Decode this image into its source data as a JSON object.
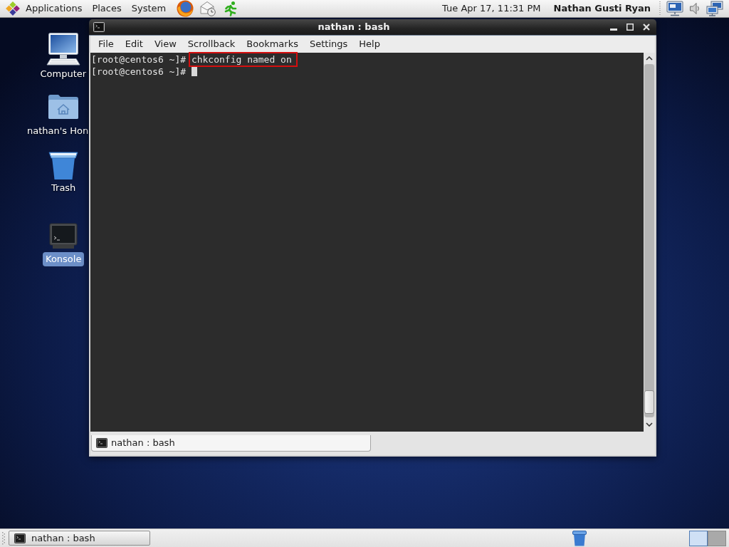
{
  "top_panel": {
    "menus": [
      "Applications",
      "Places",
      "System"
    ],
    "clock": "Tue Apr 17, 11:31 PM",
    "user": "Nathan Gusti Ryan"
  },
  "desktop_icons": [
    {
      "kind": "computer",
      "label": "Computer",
      "selected": false
    },
    {
      "kind": "home",
      "label": "nathan's Hon",
      "selected": false
    },
    {
      "kind": "trash",
      "label": "Trash",
      "selected": false
    },
    {
      "kind": "terminal",
      "label": "Konsole",
      "selected": true
    }
  ],
  "window": {
    "title": "nathan : bash",
    "menu": [
      "File",
      "Edit",
      "View",
      "Scrollback",
      "Bookmarks",
      "Settings",
      "Help"
    ],
    "terminal_lines": [
      {
        "prompt": "[root@centos6 ~]#",
        "command": "chkconfig named on",
        "highlighted": true,
        "cursor": false
      },
      {
        "prompt": "[root@centos6 ~]#",
        "highlighted": false,
        "cursor": true
      }
    ],
    "tabs": [
      {
        "label": "nathan : bash",
        "selected": true
      }
    ]
  },
  "bottom_panel": {
    "tasks": [
      {
        "label": "nathan : bash"
      }
    ],
    "workspaces": [
      {
        "selected": true
      },
      {
        "selected": false
      }
    ]
  }
}
